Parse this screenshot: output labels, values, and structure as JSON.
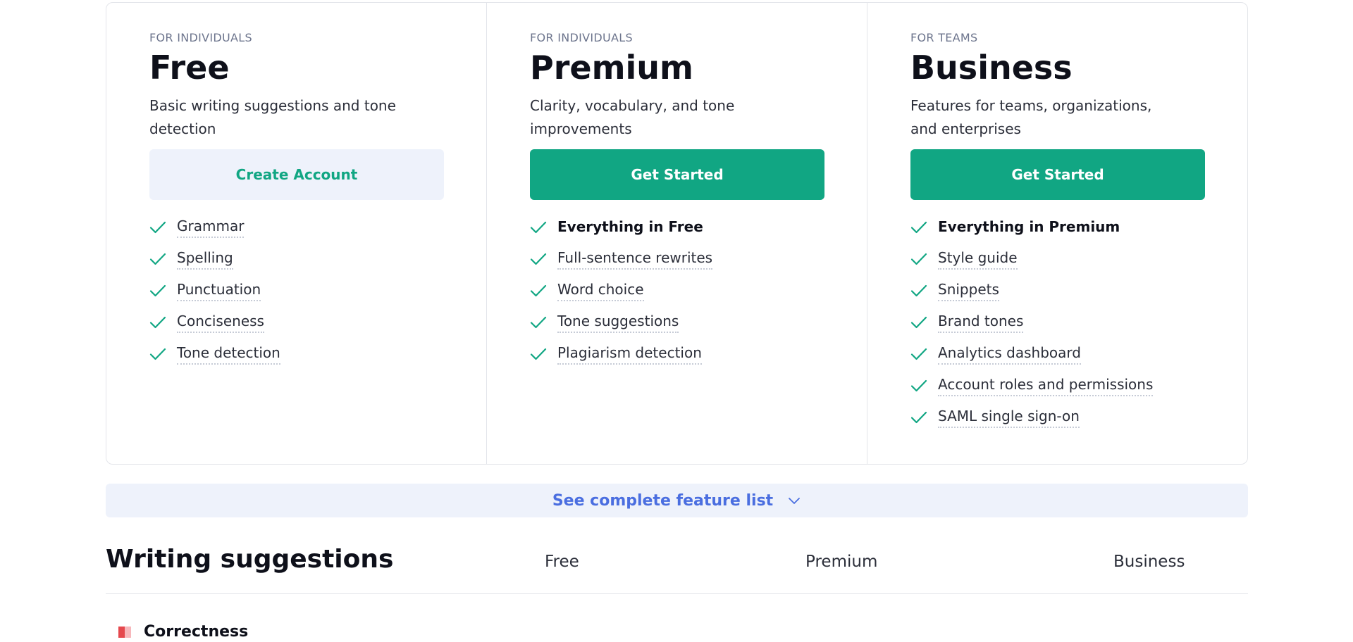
{
  "plans": [
    {
      "audience": "FOR INDIVIDUALS",
      "name": "Free",
      "description": "Basic writing suggestions and tone detection",
      "cta": "Create Account",
      "features": [
        "Grammar",
        "Spelling",
        "Punctuation",
        "Conciseness",
        "Tone detection"
      ]
    },
    {
      "audience": "FOR INDIVIDUALS",
      "name": "Premium",
      "description": "Clarity, vocabulary, and tone improvements",
      "cta": "Get Started",
      "features": [
        "Everything in Free",
        "Full-sentence rewrites",
        "Word choice",
        "Tone suggestions",
        "Plagiarism detection"
      ]
    },
    {
      "audience": "FOR TEAMS",
      "name": "Business",
      "description": "Features for teams, organizations, and enterprises",
      "cta": "Get Started",
      "features": [
        "Everything in Premium",
        "Style guide",
        "Snippets",
        "Brand tones",
        "Analytics dashboard",
        "Account roles and permissions",
        "SAML single sign-on"
      ]
    }
  ],
  "see_features": {
    "label": "See complete feature list"
  },
  "comparison": {
    "title": "Writing suggestions",
    "columns": [
      "Free",
      "Premium",
      "Business"
    ],
    "first_category": "Correctness"
  },
  "colors": {
    "accent_green": "#11a683",
    "link_blue": "#4a6ee0",
    "light_bg": "#eef2fb",
    "correctness_red": "#e5484d"
  }
}
